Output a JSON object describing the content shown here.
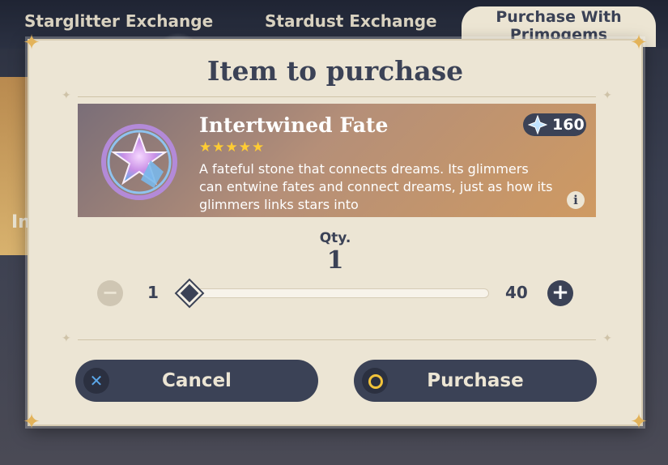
{
  "background_tabs": [
    {
      "label": "Starglitter Exchange"
    },
    {
      "label": "Stardust Exchange"
    },
    {
      "label": "Purchase With Primogems"
    }
  ],
  "background_side_label": "In",
  "dialog": {
    "title": "Item to purchase",
    "item": {
      "name": "Intertwined Fate",
      "rarity_stars": "★★★★★",
      "description": "A fateful stone that connects dreams. Its glimmers can entwine fates and connect dreams, just as how its glimmers links stars into",
      "price": "160",
      "price_icon": "primogem-icon",
      "info_icon_label": "i"
    },
    "quantity": {
      "label": "Qty.",
      "value": "1",
      "min": "1",
      "max": "40",
      "level": 0
    },
    "buttons": {
      "cancel_label": "Cancel",
      "purchase_label": "Purchase"
    }
  },
  "colors": {
    "accent_dark": "#3b4256",
    "panel": "#ece5d4",
    "star": "#ffcc33",
    "corner": "#e3b35a",
    "confirm_ring": "#f2c33a",
    "cancel_x": "#5aa6e8"
  }
}
